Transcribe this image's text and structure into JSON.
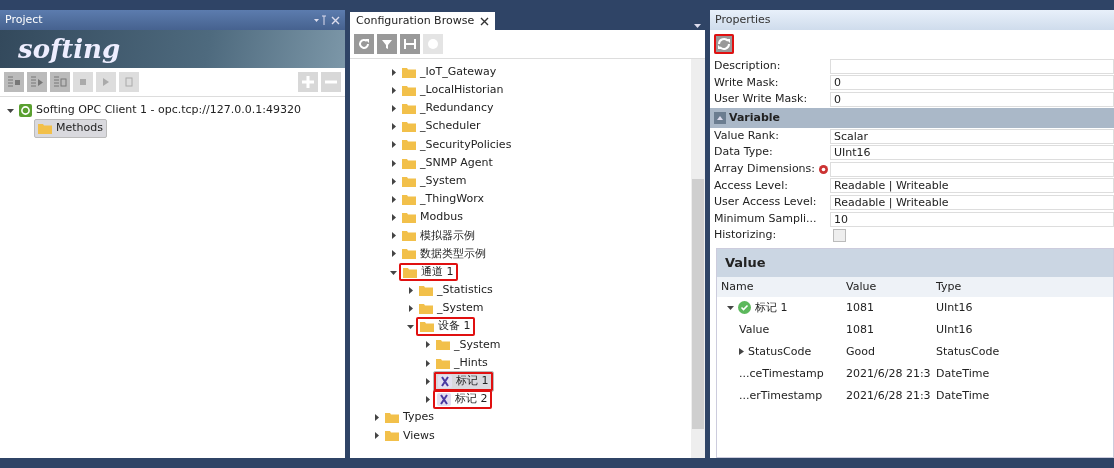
{
  "project": {
    "title": "Project",
    "logo": "softing",
    "toolbar": [
      {
        "kind": "list-stop",
        "disabled": false
      },
      {
        "kind": "list-play",
        "disabled": false
      },
      {
        "kind": "list-sync",
        "disabled": false
      },
      {
        "kind": "stop",
        "disabled": true
      },
      {
        "kind": "play",
        "disabled": true
      },
      {
        "kind": "sync",
        "disabled": true
      }
    ],
    "add_disabled": true,
    "remove_disabled": true,
    "tree": [
      {
        "label": "Softing OPC Client 1 - opc.tcp://127.0.0.1:49320",
        "kind": "client",
        "expanded": true,
        "selected": false,
        "children": [
          {
            "label": "Methods",
            "kind": "folder",
            "selected": true
          }
        ]
      }
    ]
  },
  "browser": {
    "tab": "Configuration Browse",
    "tools": [
      {
        "kind": "refresh",
        "disabled": false
      },
      {
        "kind": "filter",
        "disabled": false
      },
      {
        "kind": "fit",
        "disabled": false
      },
      {
        "kind": "stop",
        "disabled": true
      }
    ],
    "continued_items": [
      {
        "label": "_IoT_Gateway",
        "kind": "folder",
        "expanded": false,
        "selected": false,
        "highlighted": false
      },
      {
        "label": "_LocalHistorian",
        "kind": "folder",
        "expanded": false,
        "selected": false,
        "highlighted": false
      },
      {
        "label": "_Redundancy",
        "kind": "folder",
        "expanded": false,
        "selected": false,
        "highlighted": false
      },
      {
        "label": "_Scheduler",
        "kind": "folder",
        "expanded": false,
        "selected": false,
        "highlighted": false
      },
      {
        "label": "_SecurityPolicies",
        "kind": "folder",
        "expanded": false,
        "selected": false,
        "highlighted": false
      },
      {
        "label": "_SNMP Agent",
        "kind": "folder",
        "expanded": false,
        "selected": false,
        "highlighted": false
      },
      {
        "label": "_System",
        "kind": "folder",
        "expanded": false,
        "selected": false,
        "highlighted": false
      },
      {
        "label": "_ThingWorx",
        "kind": "folder",
        "expanded": false,
        "selected": false,
        "highlighted": false
      },
      {
        "label": "Modbus",
        "kind": "folder",
        "expanded": false,
        "selected": false,
        "highlighted": false
      },
      {
        "label": "模拟器示例",
        "kind": "folder",
        "expanded": false,
        "selected": false,
        "highlighted": false
      },
      {
        "label": "数据类型示例",
        "kind": "folder",
        "expanded": false,
        "selected": false,
        "highlighted": false
      },
      {
        "label": "通道 1",
        "kind": "folder",
        "expanded": true,
        "selected": false,
        "highlighted": true,
        "children": [
          {
            "label": "_Statistics",
            "kind": "folder",
            "expanded": false,
            "selected": false,
            "highlighted": false
          },
          {
            "label": "_System",
            "kind": "folder",
            "expanded": false,
            "selected": false,
            "highlighted": false
          },
          {
            "label": "设备 1",
            "kind": "folder",
            "expanded": true,
            "selected": false,
            "highlighted": true,
            "children": [
              {
                "label": "_System",
                "kind": "folder",
                "expanded": false,
                "selected": false,
                "highlighted": false
              },
              {
                "label": "_Hints",
                "kind": "folder",
                "expanded": false,
                "selected": false,
                "highlighted": false
              },
              {
                "label": "标记 1",
                "kind": "variable",
                "expanded": false,
                "selected": true,
                "highlighted": true
              },
              {
                "label": "标记 2",
                "kind": "variable",
                "expanded": false,
                "selected": false,
                "highlighted": true
              }
            ]
          }
        ]
      }
    ],
    "items": [
      {
        "label": "Types",
        "kind": "folder",
        "expanded": false,
        "selected": false,
        "highlighted": false
      },
      {
        "label": "Views",
        "kind": "folder",
        "expanded": false,
        "selected": false,
        "highlighted": false
      }
    ]
  },
  "properties": {
    "title": "Properties",
    "refresh_highlighted": true,
    "rows": [
      {
        "label": "Description:",
        "value": "",
        "kind": "text"
      },
      {
        "label": "Write Mask:",
        "value": "0",
        "kind": "text"
      },
      {
        "label": "User Write Mask:",
        "value": "0",
        "kind": "text"
      }
    ],
    "section": {
      "title": "Variable",
      "expanded": true,
      "rows": [
        {
          "label": "Value Rank:",
          "value": "Scalar",
          "kind": "text"
        },
        {
          "label": "Data Type:",
          "value": "UInt16",
          "kind": "text"
        },
        {
          "label": "Array Dimensions:",
          "value": "",
          "kind": "text",
          "error": true
        },
        {
          "label": "Access Level:",
          "value": "Readable | Writeable",
          "kind": "text"
        },
        {
          "label": "User Access Level:",
          "value": "Readable | Writeable",
          "kind": "text"
        },
        {
          "label": "Minimum Sampli...",
          "value": "10",
          "kind": "text"
        },
        {
          "label": "Historizing:",
          "checked": false,
          "kind": "checkbox"
        }
      ]
    }
  },
  "value_panel": {
    "title": "Value",
    "columns": [
      "Name",
      "Value",
      "Type"
    ],
    "rows": [
      {
        "name": "标记 1",
        "value": "1081",
        "type": "UInt16",
        "status_good": true,
        "expanded": true,
        "children": [
          {
            "name": "Value",
            "value": "1081",
            "type": "UInt16"
          },
          {
            "name": "StatusCode",
            "value": "Good",
            "type": "StatusCode",
            "expanded": false
          },
          {
            "name": "...ceTimestamp",
            "value": "2021/6/28 21:3",
            "type": "DateTime"
          },
          {
            "name": "...erTimestamp",
            "value": "2021/6/28 21:3",
            "type": "DateTime"
          }
        ]
      }
    ]
  }
}
